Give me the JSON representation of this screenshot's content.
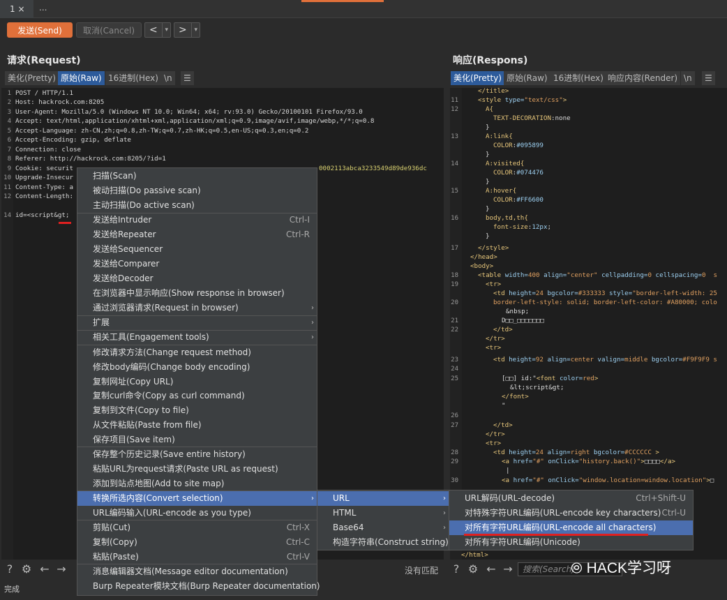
{
  "tabs": {
    "tab1": "1 ×",
    "more": "..."
  },
  "toolbar": {
    "send": "发送(Send)",
    "cancel": "取消(Cancel)",
    "back": "<",
    "forward": ">",
    "dd": "▾"
  },
  "request": {
    "title": "请求(Request)",
    "view_tabs": [
      "美化(Pretty)",
      "原始(Raw)",
      "16进制(Hex)",
      "\\n",
      "☰"
    ],
    "lines": [
      {
        "n": "1",
        "text": "POST / HTTP/1.1"
      },
      {
        "n": "2",
        "text": "Host: hackrock.com:8205"
      },
      {
        "n": "3",
        "text": "User-Agent: Mozilla/5.0 (Windows NT 10.0; Win64; x64; rv:93.0) Gecko/20100101 Firefox/93.0"
      },
      {
        "n": "4",
        "text": "Accept: text/html,application/xhtml+xml,application/xml;q=0.9,image/avif,image/webp,*/*;q=0.8"
      },
      {
        "n": "5",
        "text": "Accept-Language: zh-CN,zh;q=0.8,zh-TW;q=0.7,zh-HK;q=0.5,en-US;q=0.3,en;q=0.2"
      },
      {
        "n": "6",
        "text": "Accept-Encoding: gzip, deflate"
      },
      {
        "n": "7",
        "text": "Connection: close"
      },
      {
        "n": "8",
        "text": "Referer: http://hackrock.com:8205/?id=1"
      },
      {
        "n": "9",
        "text": "Cookie: securit"
      },
      {
        "n": "10",
        "text": "Upgrade-Insecur"
      },
      {
        "n": "11",
        "text": "Content-Type: a"
      },
      {
        "n": "12",
        "text": "Content-Length:"
      },
      {
        "n": "13",
        "text": ""
      },
      {
        "n": "14",
        "text": "id=<script&gt;"
      }
    ],
    "cookie_tail": "0002113abca3233549d89de936dc"
  },
  "response": {
    "title": "响应(Respons)",
    "view_tabs": [
      "美化(Pretty)",
      "原始(Raw)",
      "16进制(Hex)",
      "响应内容(Render)",
      "\\n",
      "☰"
    ]
  },
  "context_menu": {
    "items": [
      {
        "label": "扫描(Scan)"
      },
      {
        "label": "被动扫描(Do passive scan)"
      },
      {
        "label": "主动扫描(Do active scan)"
      },
      {
        "label": "发送给Intruder",
        "shortcut": "Ctrl-I"
      },
      {
        "label": "发送给Repeater",
        "shortcut": "Ctrl-R"
      },
      {
        "label": "发送给Sequencer"
      },
      {
        "label": "发送给Comparer"
      },
      {
        "label": "发送给Decoder"
      },
      {
        "label": "在浏览器中显示响应(Show response in browser)"
      },
      {
        "label": "通过浏览器请求(Request in browser)",
        "arrow": "›"
      },
      {
        "label": "扩展",
        "arrow": "›"
      },
      {
        "label": "相关工具(Engagement tools)",
        "arrow": "›"
      },
      {
        "label": "修改请求方法(Change request method)"
      },
      {
        "label": "修改body编码(Change body encoding)"
      },
      {
        "label": "复制网址(Copy URL)"
      },
      {
        "label": "复制curl命令(Copy as curl command)"
      },
      {
        "label": "复制到文件(Copy to file)"
      },
      {
        "label": "从文件粘贴(Paste from file)"
      },
      {
        "label": "保存项目(Save item)"
      },
      {
        "label": "保存整个历史记录(Save entire history)"
      },
      {
        "label": "粘贴URL为request请求(Paste URL as request)"
      },
      {
        "label": "添加到站点地图(Add to site map)"
      },
      {
        "label": "转换所选内容(Convert selection)",
        "arrow": "›"
      },
      {
        "label": "URL编码输入(URL-encode as you type)"
      },
      {
        "label": "剪贴(Cut)",
        "shortcut": "Ctrl-X"
      },
      {
        "label": "复制(Copy)",
        "shortcut": "Ctrl-C"
      },
      {
        "label": "粘贴(Paste)",
        "shortcut": "Ctrl-V"
      },
      {
        "label": "消息编辑器文档(Message editor documentation)"
      },
      {
        "label": "Burp Repeater模块文档(Burp Repeater documentation)"
      }
    ]
  },
  "submenu1": {
    "items": [
      {
        "label": "URL"
      },
      {
        "label": "HTML"
      },
      {
        "label": "Base64"
      },
      {
        "label": "构造字符串(Construct string)"
      }
    ]
  },
  "submenu2": {
    "items": [
      {
        "label": "URL解码(URL-decode)",
        "shortcut": "Ctrl+Shift-U"
      },
      {
        "label": "对特殊字符URL编码(URL-encode key characters)",
        "shortcut": "Ctrl-U"
      },
      {
        "label": "对所有字符URL编码(URL-encode all characters)"
      },
      {
        "label": "对所有字符URL编码(Unicode)"
      }
    ]
  },
  "bottom": {
    "no_match": "没有匹配",
    "status": "完成",
    "search_placeholder": "搜索(Search)",
    "watermark": "HACK学习呀"
  },
  "colors": {
    "accent": "#e0703a",
    "highlight": "#4b6eaf",
    "tab_active": "#2d5b9b",
    "underline": "#e02020"
  }
}
